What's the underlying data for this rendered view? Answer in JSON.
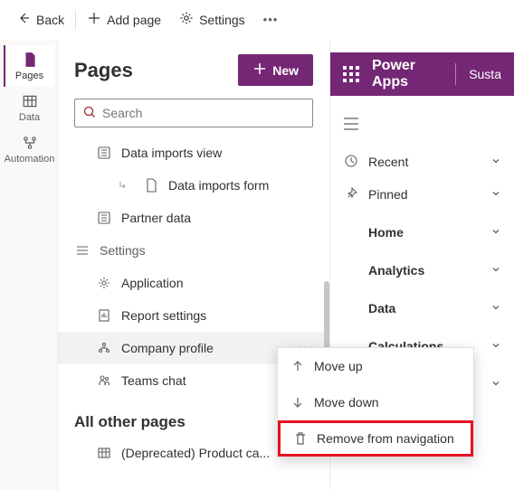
{
  "topbar": {
    "back": "Back",
    "add_page": "Add page",
    "settings": "Settings"
  },
  "rail": {
    "pages": "Pages",
    "data": "Data",
    "automation": "Automation"
  },
  "panel": {
    "title": "Pages",
    "new_btn": "New",
    "search_placeholder": "Search"
  },
  "tree": {
    "r0": "Data imports view",
    "r1": "Data imports form",
    "r2": "Partner data",
    "g_settings": "Settings",
    "r3": "Application",
    "r4": "Report settings",
    "r5": "Company profile",
    "r6": "Teams chat"
  },
  "all_other": {
    "title": "All other pages",
    "r0": "(Deprecated) Product ca..."
  },
  "context_menu": {
    "move_up": "Move up",
    "move_down": "Move down",
    "remove": "Remove from navigation"
  },
  "preview": {
    "app": "Power Apps",
    "env": "Susta",
    "recent": "Recent",
    "pinned": "Pinned",
    "home": "Home",
    "analytics": "Analytics",
    "data": "Data",
    "calculations": "Calculations"
  }
}
